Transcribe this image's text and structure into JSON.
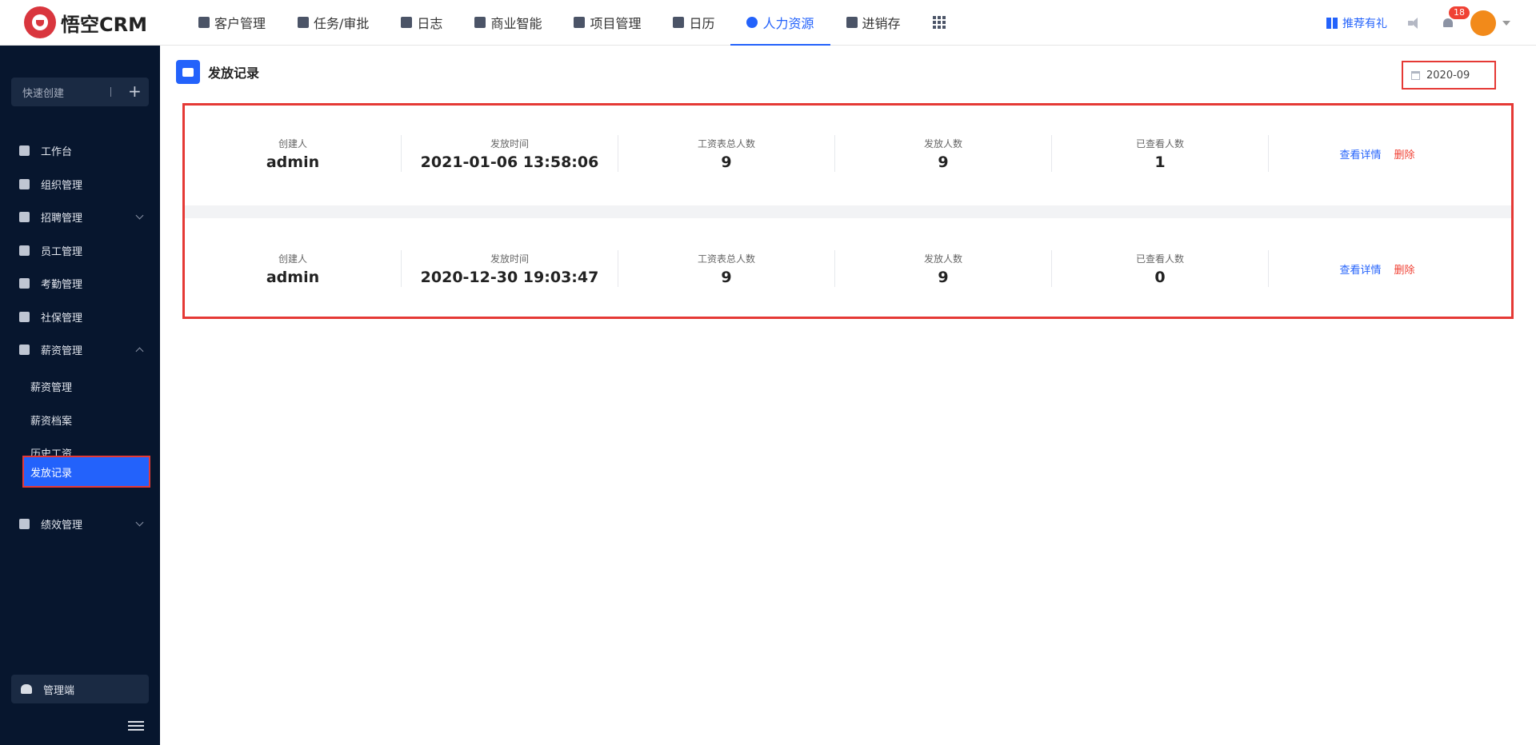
{
  "app": {
    "brand": "悟空CRM"
  },
  "nav": {
    "items": [
      {
        "label": "客户管理"
      },
      {
        "label": "任务/审批"
      },
      {
        "label": "日志"
      },
      {
        "label": "商业智能"
      },
      {
        "label": "项目管理"
      },
      {
        "label": "日历"
      },
      {
        "label": "人力资源"
      },
      {
        "label": "进销存"
      }
    ],
    "active": "人力资源"
  },
  "header": {
    "gift_label": "推荐有礼",
    "notification_count": "18"
  },
  "sidebar": {
    "quick_create": "快速创建",
    "quick_plus": "+",
    "items": [
      {
        "label": "工作台"
      },
      {
        "label": "组织管理"
      },
      {
        "label": "招聘管理"
      },
      {
        "label": "员工管理"
      },
      {
        "label": "考勤管理"
      },
      {
        "label": "社保管理"
      },
      {
        "label": "薪资管理"
      },
      {
        "label": "绩效管理"
      }
    ],
    "sub_items": [
      {
        "label": "薪资管理"
      },
      {
        "label": "薪资档案"
      },
      {
        "label": "历史工资"
      },
      {
        "label": "发放记录"
      }
    ],
    "admin_label": "管理端"
  },
  "main": {
    "title": "发放记录",
    "date_filter": "2020-09",
    "columns": [
      "创建人",
      "发放时间",
      "工资表总人数",
      "发放人数",
      "已查看人数"
    ],
    "records": [
      {
        "creator": "admin",
        "time": "2021-01-06 13:58:06",
        "total": "9",
        "issued": "9",
        "viewed": "1"
      },
      {
        "creator": "admin",
        "time": "2020-12-30 19:03:47",
        "total": "9",
        "issued": "9",
        "viewed": "0"
      }
    ],
    "action_detail": "查看详情",
    "action_delete": "删除"
  },
  "colors": {
    "accent": "#2362fb",
    "sidebar_bg": "#07162e",
    "danger": "#f04134",
    "highlight_border": "#e53935"
  }
}
